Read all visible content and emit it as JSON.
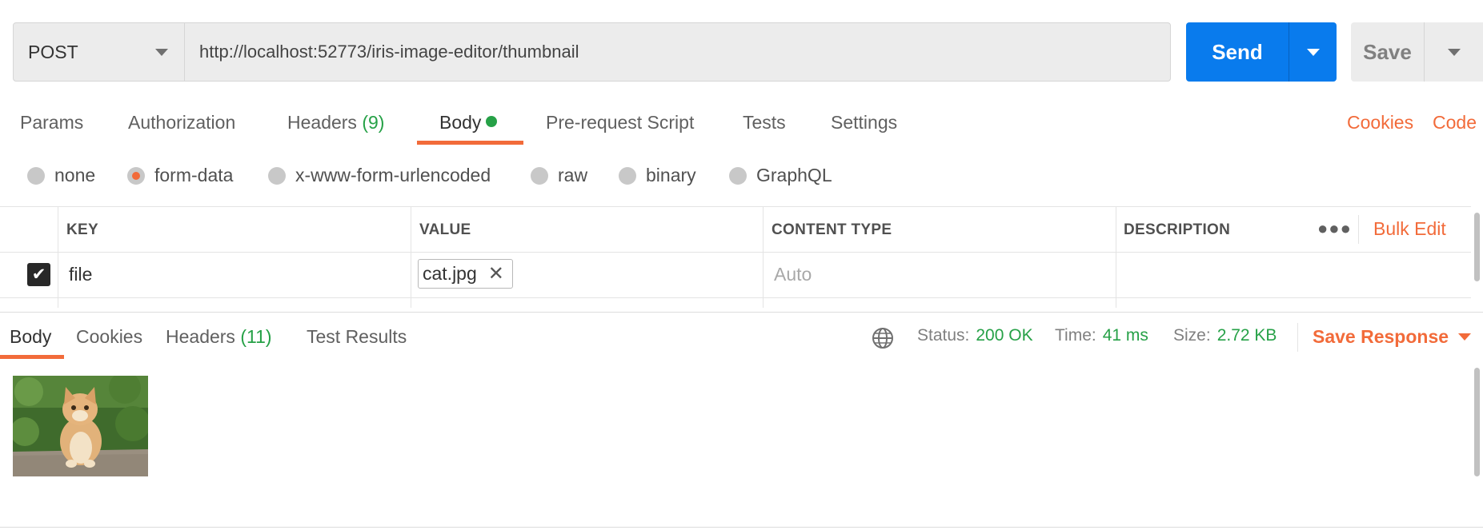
{
  "request": {
    "method": "POST",
    "url": "http://localhost:52773/iris-image-editor/thumbnail",
    "send_label": "Send",
    "save_label": "Save"
  },
  "request_tabs": {
    "params": "Params",
    "authorization": "Authorization",
    "headers": "Headers",
    "headers_count": "(9)",
    "body": "Body",
    "prerequest": "Pre-request Script",
    "tests": "Tests",
    "settings": "Settings",
    "cookies": "Cookies",
    "code": "Code"
  },
  "body_types": [
    "none",
    "form-data",
    "x-www-form-urlencoded",
    "raw",
    "binary",
    "GraphQL"
  ],
  "body_type_selected": "form-data",
  "form_table": {
    "headers": [
      "KEY",
      "VALUE",
      "CONTENT TYPE",
      "DESCRIPTION"
    ],
    "bulk_edit": "Bulk Edit",
    "rows": [
      {
        "checked": true,
        "key": "file",
        "value": "cat.jpg",
        "content_type": "Auto",
        "description": ""
      }
    ]
  },
  "response": {
    "tabs": {
      "body": "Body",
      "cookies": "Cookies",
      "headers": "Headers",
      "headers_count": "(11)",
      "test_results": "Test Results"
    },
    "status_label": "Status:",
    "status_value": "200 OK",
    "time_label": "Time:",
    "time_value": "41 ms",
    "size_label": "Size:",
    "size_value": "2.72 KB",
    "save_response": "Save Response"
  },
  "colors": {
    "accent": "#f26b3a",
    "send": "#097bed",
    "success": "#26a147"
  },
  "icons": [
    "dropdown-caret-icon",
    "close-icon",
    "checkmark-icon",
    "more-icon",
    "globe-icon"
  ]
}
